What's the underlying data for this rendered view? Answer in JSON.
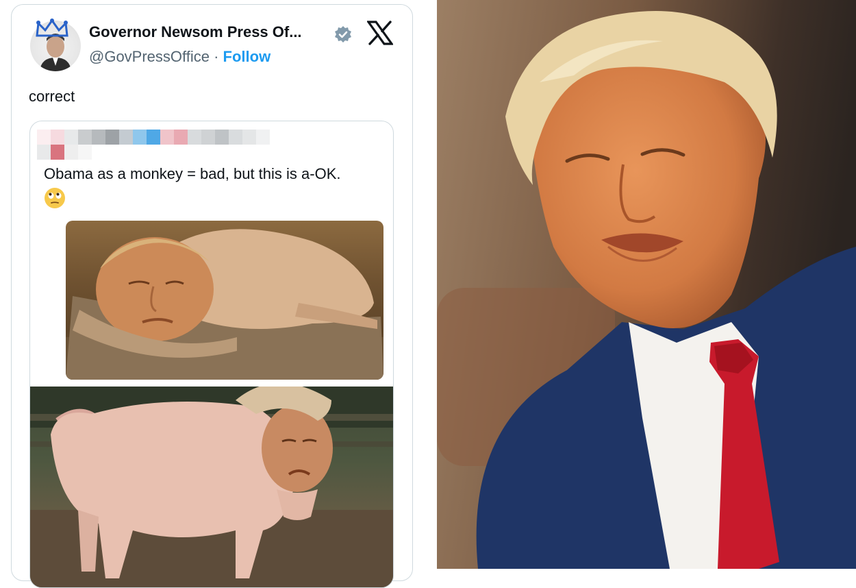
{
  "tweet": {
    "display_name": "Governor Newsom Press Of...",
    "handle": "@GovPressOffice",
    "separator": " · ",
    "follow_label": "Follow",
    "text": "correct",
    "verified_color": "#829aab",
    "follow_color": "#1d9bf0",
    "brand_icon": "x-logo-icon",
    "quote": {
      "author_obscured": true,
      "text": "Obama as a monkey = bad, but this is a-OK.",
      "emoji": "face-with-rolling-eyes"
    }
  },
  "colors": {
    "card_border": "#cfd9de",
    "text_primary": "#0f1419",
    "text_secondary": "#536471",
    "tie_red": "#c81a2c",
    "suit_navy": "#1f3566"
  }
}
